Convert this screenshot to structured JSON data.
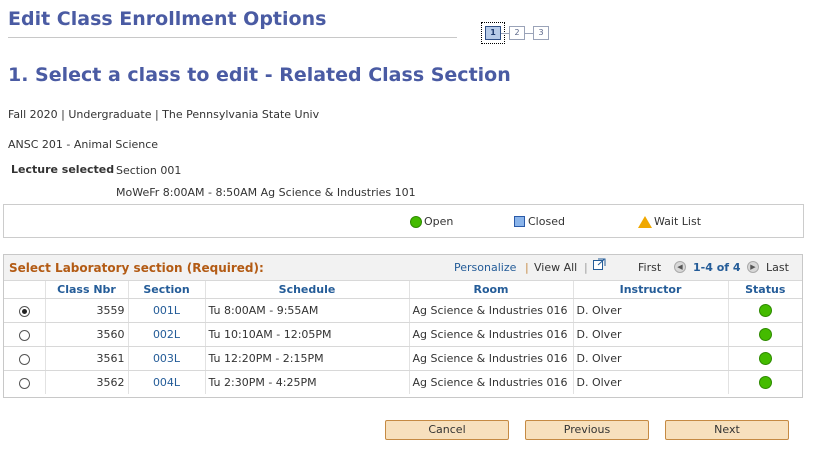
{
  "page_title": "Edit Class Enrollment Options",
  "steps": [
    "1",
    "2",
    "3"
  ],
  "section_heading": "1.  Select a class to edit - Related Class Section",
  "term_info": "Fall 2020 | Undergraduate | The Pennsylvania State Univ",
  "course": "ANSC  201 - Animal Science",
  "lecture": {
    "label": "Lecture selected",
    "section": "Section 001",
    "schedule": "MoWeFr 8:00AM - 8:50AM   Ag Science & Industries 101"
  },
  "legend": {
    "open": "Open",
    "closed": "Closed",
    "wait_list": "Wait List"
  },
  "grid": {
    "title": "Select Laboratory section (Required):",
    "personalize": "Personalize",
    "view_all": "View All",
    "first": "First",
    "range": "1-4 of 4",
    "last": "Last",
    "columns": [
      "Class Nbr",
      "Section",
      "Schedule",
      "Room",
      "Instructor",
      "Status"
    ],
    "rows": [
      {
        "selected": true,
        "class_nbr": "3559",
        "section": "001L",
        "schedule": "Tu 8:00AM - 9:55AM",
        "room": "Ag Science & Industries 016",
        "instructor": "D. Olver",
        "status": "open"
      },
      {
        "selected": false,
        "class_nbr": "3560",
        "section": "002L",
        "schedule": "Tu 10:10AM - 12:05PM",
        "room": "Ag Science & Industries 016",
        "instructor": "D. Olver",
        "status": "open"
      },
      {
        "selected": false,
        "class_nbr": "3561",
        "section": "003L",
        "schedule": "Tu 12:20PM - 2:15PM",
        "room": "Ag Science & Industries 016",
        "instructor": "D. Olver",
        "status": "open"
      },
      {
        "selected": false,
        "class_nbr": "3562",
        "section": "004L",
        "schedule": "Tu 2:30PM - 4:25PM",
        "room": "Ag Science & Industries 016",
        "instructor": "D. Olver",
        "status": "open"
      }
    ]
  },
  "buttons": {
    "cancel": "Cancel",
    "previous": "Previous",
    "next": "Next"
  },
  "colors": {
    "title": "#4a5ba3",
    "grid_title": "#b35b14",
    "link": "#245c98",
    "open": "#44bb00",
    "button_bg": "#f7e0bd"
  }
}
